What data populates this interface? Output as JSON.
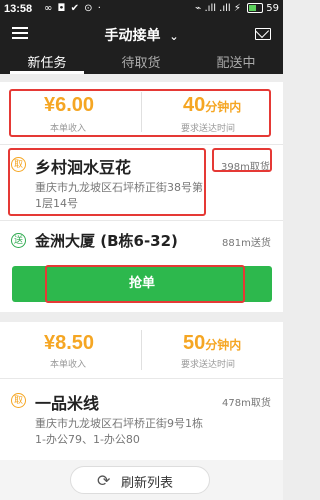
{
  "statusbar": {
    "time": "13:58",
    "left_icons": "∞ ◘ ✔ ⊙ ·",
    "right_icons": "⌁ .ıll .ıll ⚡",
    "battery": "59"
  },
  "appbar": {
    "title": "手动接单",
    "title_caret": "⌄"
  },
  "tabs": [
    {
      "label": "新任务"
    },
    {
      "label": "待取货"
    },
    {
      "label": "配送中"
    }
  ],
  "order1": {
    "price": "¥6.00",
    "price_label": "本单收入",
    "deliver_time": "40",
    "deliver_time_unit": "分钟内",
    "deliver_time_label": "要求送达时间",
    "pickup": {
      "badge": "取",
      "name": "乡村洄水豆花",
      "address": "重庆市九龙坡区石坪桥正街38号第1层14号",
      "distance": "398m取货"
    },
    "dropoff": {
      "badge": "送",
      "name": "金洲大厦 (B栋6-32)",
      "distance": "881m送货"
    },
    "button_label": "抢单"
  },
  "order2": {
    "price": "¥8.50",
    "price_label": "本单收入",
    "deliver_time": "50",
    "deliver_time_unit": "分钟内",
    "deliver_time_label": "要求送达时间",
    "pickup": {
      "badge": "取",
      "name": "一品米线",
      "address": "重庆市九龙坡区石坪桥正街9号1栋1-办公79、1-办公80",
      "distance": "478m取货"
    }
  },
  "refresh": {
    "label": "刷新列表",
    "icon": "refresh-icon"
  },
  "colors": {
    "accent_orange": "#f5a623",
    "accent_green": "#2db84d",
    "highlight_red": "#e53935"
  }
}
